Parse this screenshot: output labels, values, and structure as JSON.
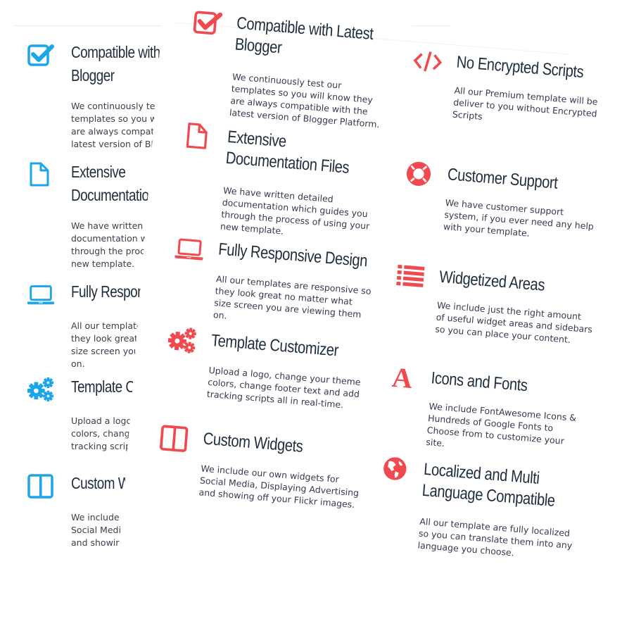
{
  "colors": {
    "background_accent": "#1aa6e8",
    "card_accent": "#f04a50",
    "heading": "#1f2d3d",
    "body_text": "#3d3550"
  },
  "background_column": {
    "items": [
      {
        "icon": "checkbox-icon",
        "title": "Compatible with\nBlogger",
        "desc": "We continuously test o\ntemplates so you will k\nare always compatible\nlatest version of Blogg"
      },
      {
        "icon": "file-icon",
        "title": "Extensive\nDocumentatio",
        "desc": "We have written de\ndocumentation whi\nthrough the proces\nnew template."
      },
      {
        "icon": "laptop-icon",
        "title": "Fully Respon",
        "desc": "All our templates\nthey look great r\nsize screen you\non."
      },
      {
        "icon": "gears-icon",
        "title": "Template C",
        "desc": "Upload a logo,\ncolors, change\ntracking scrip"
      },
      {
        "icon": "columns-icon",
        "title": "Custom W",
        "desc": "We include\nSocial Medi\nand showir"
      }
    ]
  },
  "card": {
    "left_column": [
      {
        "icon": "checkbox-icon",
        "title": "Compatible with Latest\nBlogger",
        "desc": "We continuously test our\ntemplates so you will know they\nare always compatible with the\nlatest version of Blogger Platform."
      },
      {
        "icon": "file-icon",
        "title": "Extensive\nDocumentation Files",
        "desc": "We have written detailed\ndocumentation which guides you\nthrough the process of using your\nnew template."
      },
      {
        "icon": "laptop-icon",
        "title": "Fully Responsive Design",
        "desc": "All our templates are responsive so\nthey look great no matter what\nsize screen you are viewing them\non."
      },
      {
        "icon": "gears-icon",
        "title": "Template Customizer",
        "desc": "Upload a logo, change your theme\ncolors, change footer text and add\ntracking scripts all in real-time."
      },
      {
        "icon": "columns-icon",
        "title": "Custom Widgets",
        "desc": "We include our own widgets for\nSocial Media, Displaying Advertising\nand showing off your Flickr images."
      }
    ],
    "right_column": [
      {
        "icon": "code-icon",
        "title": "No Encrypted Scripts",
        "desc": "All our Premium template will be\ndeliver to you without Encrypted\nScripts"
      },
      {
        "icon": "lifebuoy-icon",
        "title": "Customer Support",
        "desc": "We have customer support\nsystem, if you ever need any help\nwith your template."
      },
      {
        "icon": "list-icon",
        "title": "Widgetized Areas",
        "desc": "We include just the right amount\nof useful widget areas and sidebars\nso you can place your content."
      },
      {
        "icon": "font-icon",
        "title": "Icons and Fonts",
        "desc": "We include FontAwesome Icons &\nHundreds of Google Fonts to\nChoose from to customize your\nsite."
      },
      {
        "icon": "globe-icon",
        "title": "Localized and Multi\nLanguage Compatible",
        "desc": "All our template are fully localized\nso you can translate them into any\nlanguage you choose."
      }
    ]
  }
}
